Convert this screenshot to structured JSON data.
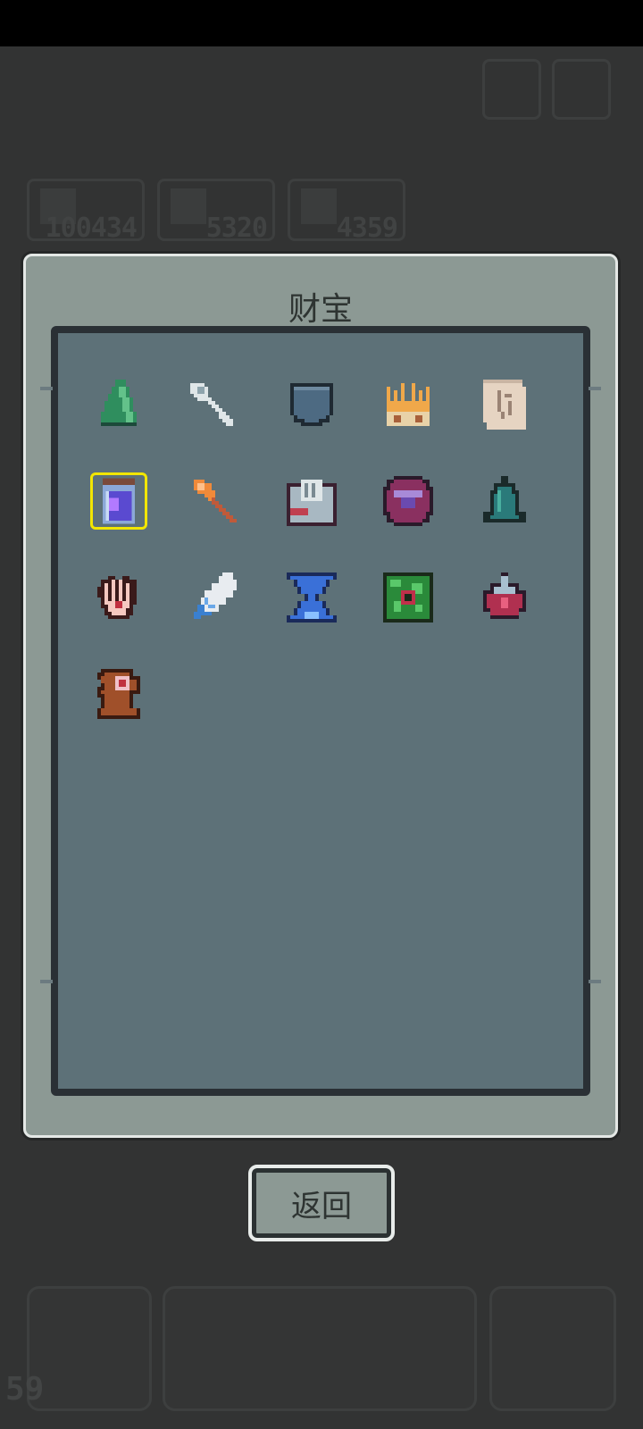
{
  "dialog": {
    "title": "财宝",
    "back_label": "返回"
  },
  "background_hud": {
    "stats": [
      "100434",
      "5320",
      "4359"
    ],
    "bottom_count": "59"
  },
  "treasures": [
    {
      "name": "green-leaf-icon",
      "selected": false
    },
    {
      "name": "bone-key-icon",
      "selected": false
    },
    {
      "name": "pocket-icon",
      "selected": false
    },
    {
      "name": "golden-crown-icon",
      "selected": false
    },
    {
      "name": "ancient-scroll-icon",
      "selected": false
    },
    {
      "name": "purple-potion-jar-icon",
      "selected": true
    },
    {
      "name": "fire-axe-icon",
      "selected": false
    },
    {
      "name": "spellbook-icon",
      "selected": false
    },
    {
      "name": "purple-gem-orb-icon",
      "selected": false
    },
    {
      "name": "teal-bell-icon",
      "selected": false
    },
    {
      "name": "open-palm-icon",
      "selected": false
    },
    {
      "name": "blue-feather-icon",
      "selected": false
    },
    {
      "name": "hourglass-icon",
      "selected": false
    },
    {
      "name": "green-rune-tablet-icon",
      "selected": false
    },
    {
      "name": "red-crystal-shard-icon",
      "selected": false
    },
    {
      "name": "wooden-totem-icon",
      "selected": false
    }
  ],
  "colors": {
    "background": "#323333",
    "dialog_frame": "#8c9994",
    "inner_panel": "#5d7178",
    "selection": "#f2e600"
  }
}
